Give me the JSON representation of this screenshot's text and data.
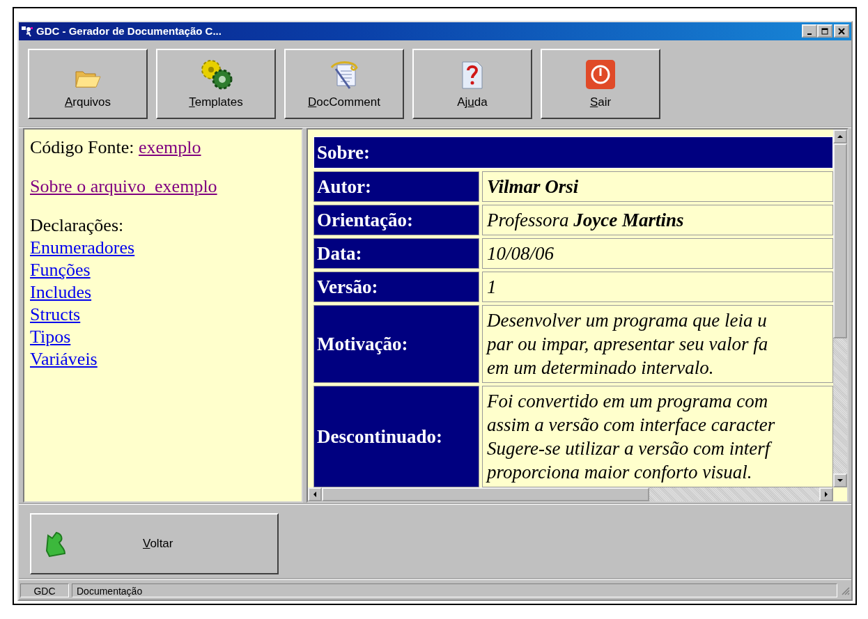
{
  "window": {
    "title": "GDC - Gerador de Documentação C..."
  },
  "toolbar": [
    {
      "label": {
        "key": "A",
        "after": "rquivos"
      },
      "kind": "folder"
    },
    {
      "label": {
        "key": "T",
        "after": "emplates"
      },
      "kind": "gears"
    },
    {
      "label": {
        "key": "D",
        "after": "ocComment"
      },
      "kind": "doc"
    },
    {
      "label": {
        "before": "Aj",
        "key": "u",
        "after": "da"
      },
      "kind": "help"
    },
    {
      "label": {
        "key": "S",
        "after": "air"
      },
      "kind": "power"
    }
  ],
  "left_pane": {
    "source_label": "Código Fonte:",
    "source_link": {
      "text": "exemplo",
      "visited": true
    },
    "about_link": {
      "text": "Sobre o arquivo  exemplo",
      "visited": true
    },
    "declarations_heading": "Declarações:",
    "declarations": [
      {
        "text": "Enumeradores",
        "visited": false
      },
      {
        "text": "Funções",
        "visited": false
      },
      {
        "text": "Includes",
        "visited": false
      },
      {
        "text": "Structs",
        "visited": false
      },
      {
        "text": "Tipos",
        "visited": false
      },
      {
        "text": "Variáveis",
        "visited": false
      }
    ]
  },
  "about_table": {
    "heading": "Sobre:",
    "rows": [
      {
        "label": "Autor:",
        "lines": [
          "Vilmar Orsi"
        ],
        "bold": true
      },
      {
        "label": "Orientação:",
        "lines": [
          "Professora **Joyce Martins**"
        ],
        "bold": false
      },
      {
        "label": "Data:",
        "lines": [
          "10/08/06"
        ],
        "bold": false
      },
      {
        "label": "Versão:",
        "lines": [
          "1"
        ],
        "bold": false
      },
      {
        "label": "Motivação:",
        "lines": [
          "Desenvolver um programa que leia u",
          "par ou impar, apresentar seu valor fa",
          "em um determinado intervalo."
        ],
        "bold": false
      },
      {
        "label": "Descontinuado:",
        "lines": [
          "Foi convertido em um programa com",
          "assim a versão com interface caracter",
          "Sugere-se utilizar a versão com interf",
          "proporciona maior conforto visual."
        ],
        "bold": false
      }
    ]
  },
  "back_button": {
    "label": {
      "key": "V",
      "after": "oltar"
    }
  },
  "status_bar": [
    "GDC",
    "Documentação"
  ]
}
